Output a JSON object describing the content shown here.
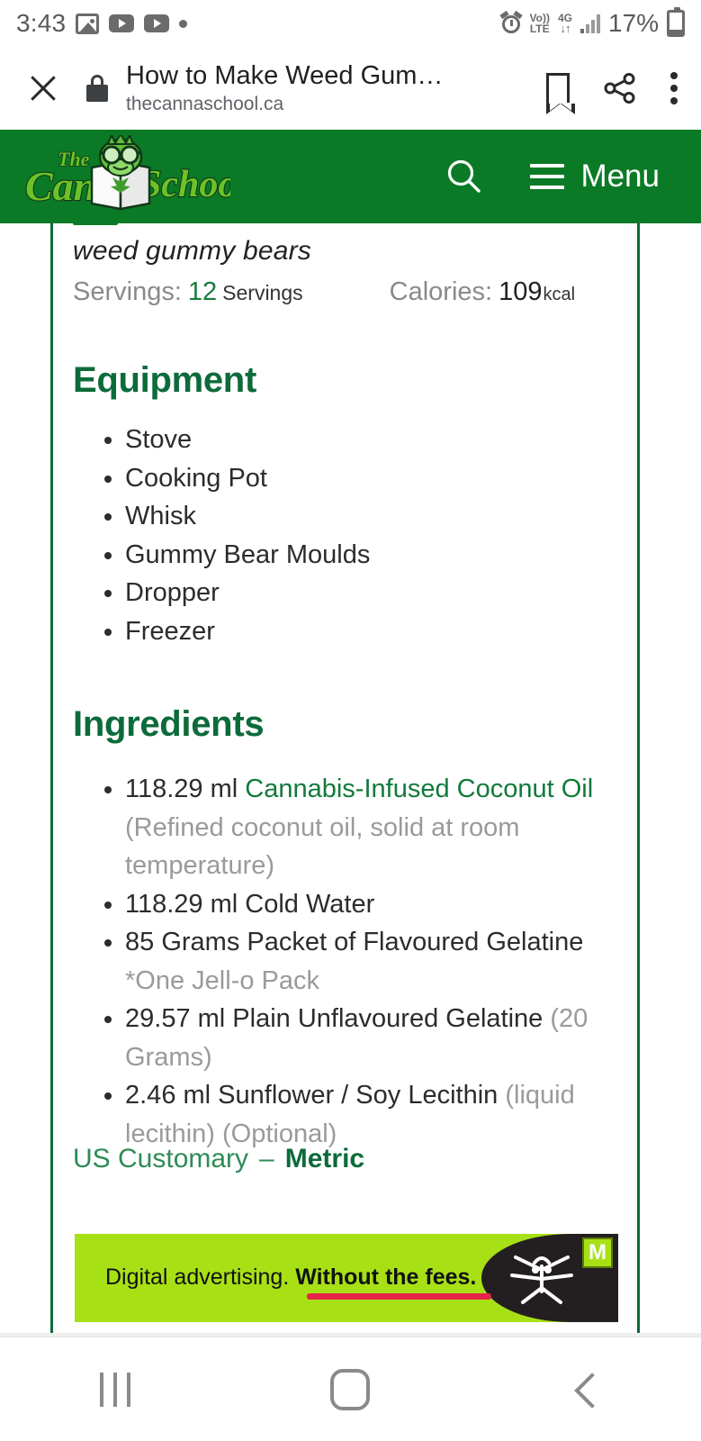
{
  "status_bar": {
    "time": "3:43",
    "icons_left": [
      "image-icon",
      "youtube-icon",
      "youtube-icon",
      "dot-icon"
    ],
    "network": {
      "volte_line1": "Vo))",
      "volte_line2": "LTE",
      "gen": "4G",
      "arrows": "↓↑"
    },
    "battery_percent": "17%",
    "alarm": "alarm-icon"
  },
  "browser_bar": {
    "close_label": "close-icon",
    "lock_label": "lock-icon",
    "page_title": "How to Make Weed Gum…",
    "page_url": "thecannaschool.ca",
    "bookmark_label": "bookmark-icon",
    "share_label": "share-icon",
    "more_label": "more-options-icon"
  },
  "site_header": {
    "logo_the": "The",
    "logo_canna": "Canna",
    "logo_school": "School",
    "search_label": "search-icon",
    "menu_label": "Menu",
    "bg_color": "#0b7a26"
  },
  "recipe": {
    "subtitle": "weed gummy bears",
    "servings_label": "Servings:",
    "servings_value": "12",
    "servings_unit": "Servings",
    "calories_label": "Calories:",
    "calories_value": "109",
    "calories_unit": "kcal",
    "equipment": {
      "heading": "Equipment",
      "items": [
        "Stove",
        "Cooking Pot",
        "Whisk",
        "Gummy Bear Moulds",
        "Dropper",
        "Freezer"
      ]
    },
    "ingredients": {
      "heading": "Ingredients",
      "items": [
        {
          "amount": "118.29 ml ",
          "name": "Cannabis-Infused Coconut Oil",
          "name_is_link": true,
          "note": " (Refined coconut oil, solid at room temperature)"
        },
        {
          "amount": "118.29 ml ",
          "name": "Cold Water",
          "name_is_link": false,
          "note": ""
        },
        {
          "amount": "85 Grams ",
          "name": "Packet of Flavoured Gelatine",
          "name_is_link": false,
          "note": " *One Jell-o Pack"
        },
        {
          "amount": "29.57 ml ",
          "name": "Plain Unflavoured Gelatine",
          "name_is_link": false,
          "note": " (20 Grams)"
        },
        {
          "amount": "2.46 ml ",
          "name": "Sunflower / Soy Lecithin",
          "name_is_link": false,
          "note": " (liquid lecithin) (Optional)"
        }
      ]
    },
    "units": {
      "inactive": "US Customary",
      "separator": "–",
      "active": "Metric"
    },
    "border_color": "#0c6b3a",
    "heading_color": "#0c6b3a"
  },
  "ad": {
    "text_normal": "Digital advertising. ",
    "text_bold": "Without the fees.",
    "badge": "M",
    "bg_color": "#a8e016",
    "dark_color": "#231f20",
    "underline_color": "#e8234a"
  },
  "nav_bar": {
    "recents": "recents-icon",
    "home": "home-icon",
    "back": "back-icon"
  }
}
